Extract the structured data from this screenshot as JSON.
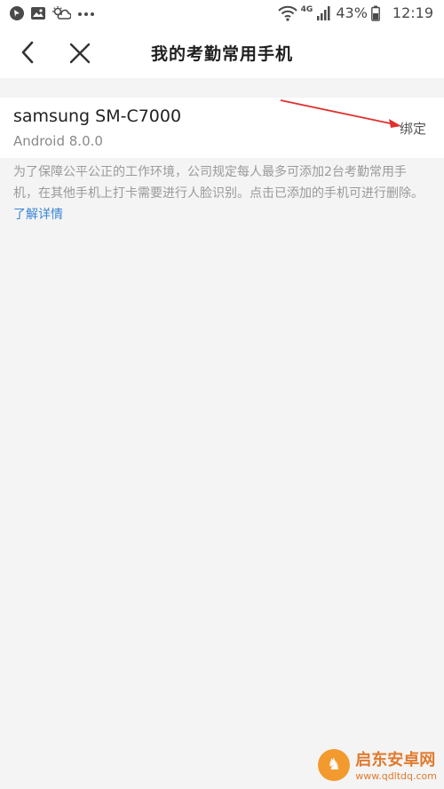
{
  "status_bar": {
    "battery_percent": "43%",
    "time": "12:19",
    "network_label": "4G"
  },
  "nav": {
    "title": "我的考勤常用手机"
  },
  "device": {
    "name": "samsung SM-C7000",
    "os": "Android 8.0.0",
    "bind_label": "绑定"
  },
  "notice": {
    "text": "为了保障公平公正的工作环境，公司规定每人最多可添加2台考勤常用手机，在其他手机上打卡需要进行人脸识别。点击已添加的手机可进行删除。",
    "link_label": "了解详情"
  },
  "watermark": {
    "name": "启东安卓网",
    "url": "www.qdltdq.com"
  },
  "colors": {
    "link": "#3a86d1",
    "arrow": "#e0312d",
    "watermark": "#e07a2c"
  }
}
